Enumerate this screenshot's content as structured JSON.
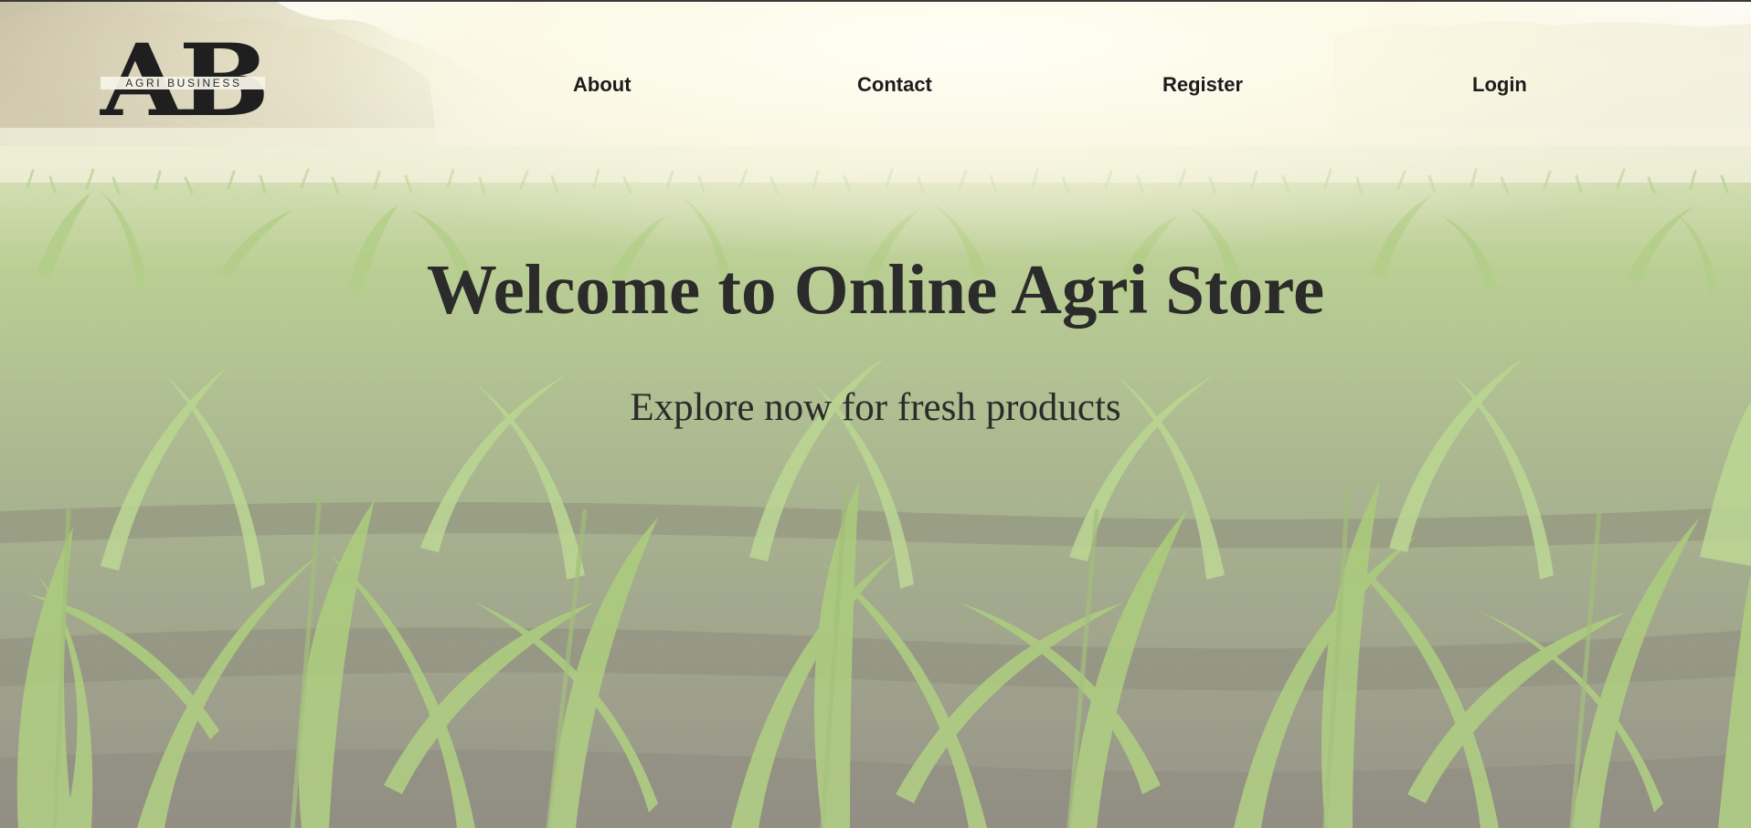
{
  "brand": {
    "logo_letters": "AB",
    "logo_tagline": "AGRI BUSINESS"
  },
  "nav": {
    "items": [
      {
        "label": "About"
      },
      {
        "label": "Contact"
      },
      {
        "label": "Register"
      },
      {
        "label": "Login"
      }
    ]
  },
  "hero": {
    "title": "Welcome to Online Agri Store",
    "subtitle": "Explore now for fresh products"
  },
  "colors": {
    "text_dark": "#2b2b2b",
    "nav_text": "#1c1c1c",
    "field_green": "#9cc06a",
    "soil": "#5f5a4c",
    "sky_haze": "#f6f4e6"
  },
  "background": {
    "icon": "corn-field-photo"
  }
}
